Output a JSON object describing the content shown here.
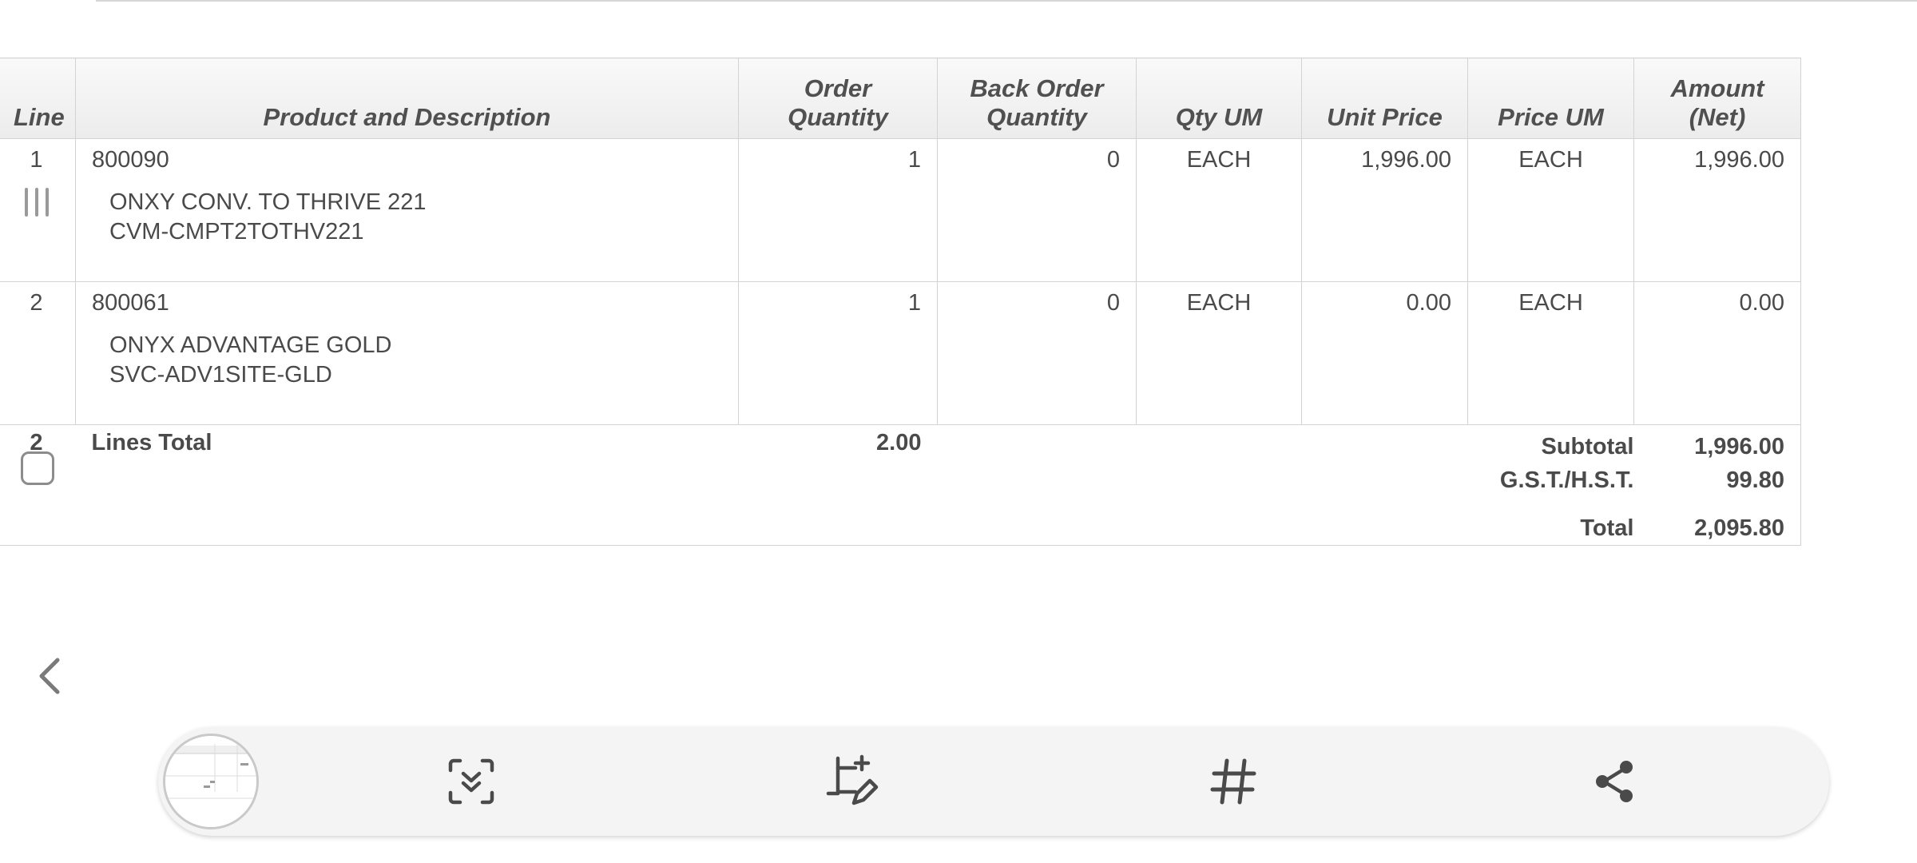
{
  "table": {
    "headers": {
      "line": "Line",
      "product": "Product and Description",
      "order_qty": "Order Quantity",
      "back_order_line1": "Back Order",
      "back_order_line2": "Quantity",
      "qty_um": "Qty UM",
      "unit_price": "Unit Price",
      "price_um": "Price UM",
      "amount_line1": "Amount",
      "amount_line2": "(Net)"
    },
    "rows": [
      {
        "line": "1",
        "product_code": "800090",
        "desc1": "ONXY CONV. TO THRIVE 221",
        "desc2": "CVM-CMPT2TOTHV221",
        "order_qty": "1",
        "back_order_qty": "0",
        "qty_um": "EACH",
        "unit_price": "1,996.00",
        "price_um": "EACH",
        "amount": "1,996.00"
      },
      {
        "line": "2",
        "product_code": "800061",
        "desc1": "ONYX ADVANTAGE GOLD",
        "desc2": "SVC-ADV1SITE-GLD",
        "order_qty": "1",
        "back_order_qty": "0",
        "qty_um": "EACH",
        "unit_price": "0.00",
        "price_um": "EACH",
        "amount": "0.00"
      }
    ],
    "totals": {
      "line_count": "2",
      "lines_total_label": "Lines Total",
      "qty_total": "2.00",
      "subtotal_label": "Subtotal",
      "subtotal_value": "1,996.00",
      "tax_label": "G.S.T./H.S.T.",
      "tax_value": "99.80",
      "total_label": "Total",
      "total_value": "2,095.80"
    }
  },
  "toolbar": {
    "buttons": [
      {
        "name": "thumbnail-preview",
        "icon": "screenshot-thumbnail"
      },
      {
        "name": "scroll-capture",
        "icon": "scroll-capture-icon"
      },
      {
        "name": "crop-edit",
        "icon": "crop-edit-icon"
      },
      {
        "name": "tags",
        "icon": "hashtag-icon"
      },
      {
        "name": "share",
        "icon": "share-icon"
      }
    ]
  },
  "colors": {
    "text": "#4a4a4a",
    "header_bg": "#efefef",
    "border": "#d3d3d3",
    "toolbar_bg": "#f4f4f4"
  }
}
